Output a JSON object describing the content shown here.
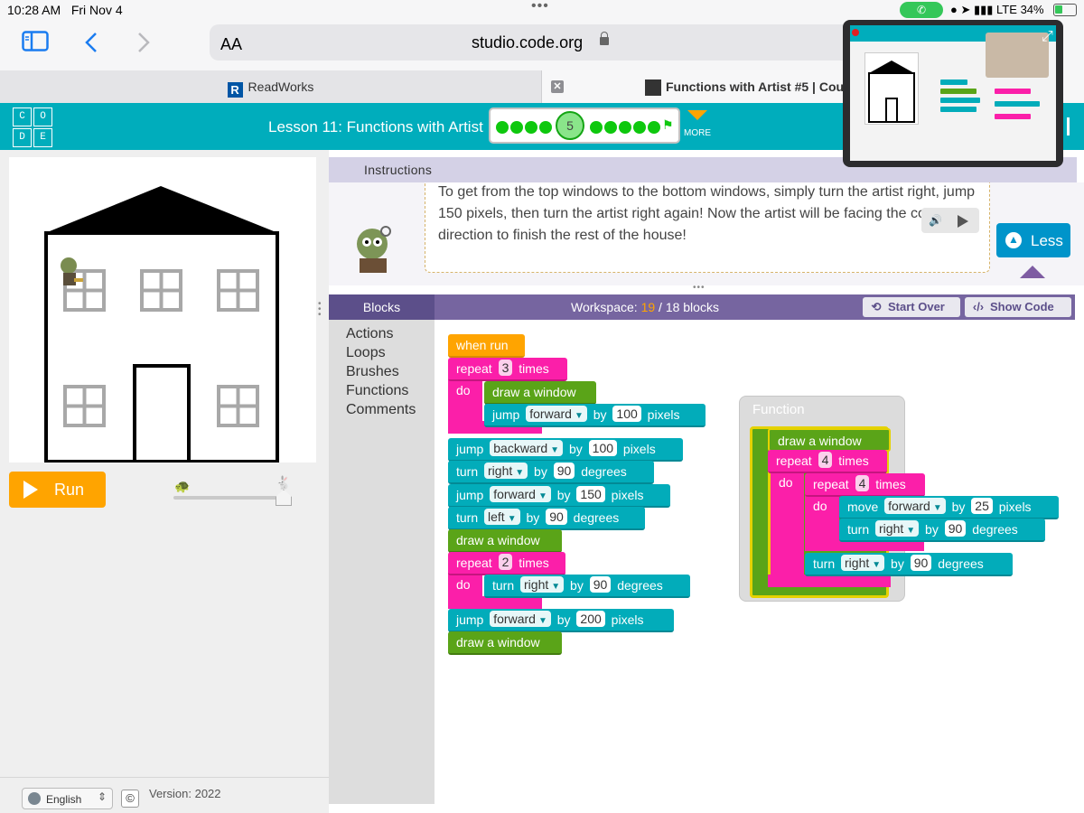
{
  "status_bar": {
    "time": "10:28 AM",
    "day": "Fri Nov 4",
    "network": "LTE",
    "battery": "34%"
  },
  "browser": {
    "text_size": "AA",
    "url": "studio.code.org",
    "tabs": [
      {
        "label": "ReadWorks"
      },
      {
        "label": "Functions with Artist #5 | Cour"
      }
    ]
  },
  "header": {
    "logo_letters": [
      "C",
      "O",
      "D",
      "E"
    ],
    "lesson_title": "Lesson 11: Functions with Artist",
    "current_level": "5",
    "more_label": "MORE"
  },
  "instructions": {
    "title": "Instructions",
    "text": "To get from the top windows to the bottom windows, simply turn the artist right, jump 150 pixels, then turn the artist right again! Now the artist will be facing the correct direction to finish the rest of the house!",
    "less_label": "Less"
  },
  "run": {
    "label": "Run"
  },
  "footer": {
    "language": "English",
    "copyright": "©",
    "version": "Version: 2022"
  },
  "workspace": {
    "blocks_title": "Blocks",
    "label_prefix": "Workspace:",
    "count": "19",
    "separator": "/",
    "limit": "18 blocks",
    "start_over": "Start Over",
    "show_code": "Show Code",
    "categories": [
      "Actions",
      "Loops",
      "Brushes",
      "Functions",
      "Comments"
    ]
  },
  "program": {
    "when_run": "when run",
    "repeat1": {
      "kw": "repeat",
      "n": "3",
      "times": "times",
      "do": "do"
    },
    "draw_a_window": "draw a window",
    "jump1": {
      "kw": "jump",
      "dir": "forward",
      "by": "by",
      "n": "100",
      "unit": "pixels"
    },
    "jump2": {
      "kw": "jump",
      "dir": "backward",
      "by": "by",
      "n": "100",
      "unit": "pixels"
    },
    "turn1": {
      "kw": "turn",
      "dir": "right",
      "by": "by",
      "n": "90",
      "unit": "degrees"
    },
    "jump3": {
      "kw": "jump",
      "dir": "forward",
      "by": "by",
      "n": "150",
      "unit": "pixels"
    },
    "turn2": {
      "kw": "turn",
      "dir": "left",
      "by": "by",
      "n": "90",
      "unit": "degrees"
    },
    "repeat2": {
      "kw": "repeat",
      "n": "2",
      "times": "times",
      "do": "do"
    },
    "turn3": {
      "kw": "turn",
      "dir": "right",
      "by": "by",
      "n": "90",
      "unit": "degrees"
    },
    "jump4": {
      "kw": "jump",
      "dir": "forward",
      "by": "by",
      "n": "200",
      "unit": "pixels"
    }
  },
  "function_def": {
    "title": "Function",
    "name": "draw a window",
    "repeat_outer": {
      "kw": "repeat",
      "n": "4",
      "times": "times",
      "do": "do"
    },
    "repeat_inner": {
      "kw": "repeat",
      "n": "4",
      "times": "times",
      "do": "do"
    },
    "move": {
      "kw": "move",
      "dir": "forward",
      "by": "by",
      "n": "25",
      "unit": "pixels"
    },
    "turn_inner": {
      "kw": "turn",
      "dir": "right",
      "by": "by",
      "n": "90",
      "unit": "degrees"
    },
    "turn_outer": {
      "kw": "turn",
      "dir": "right",
      "by": "by",
      "n": "90",
      "unit": "degrees"
    }
  },
  "colors": {
    "teal": "#00adbc",
    "orange": "#ffa400",
    "purple": "#7665a0",
    "pink": "#fb1fa9",
    "action": "#02acba",
    "function": "#5aa418"
  }
}
